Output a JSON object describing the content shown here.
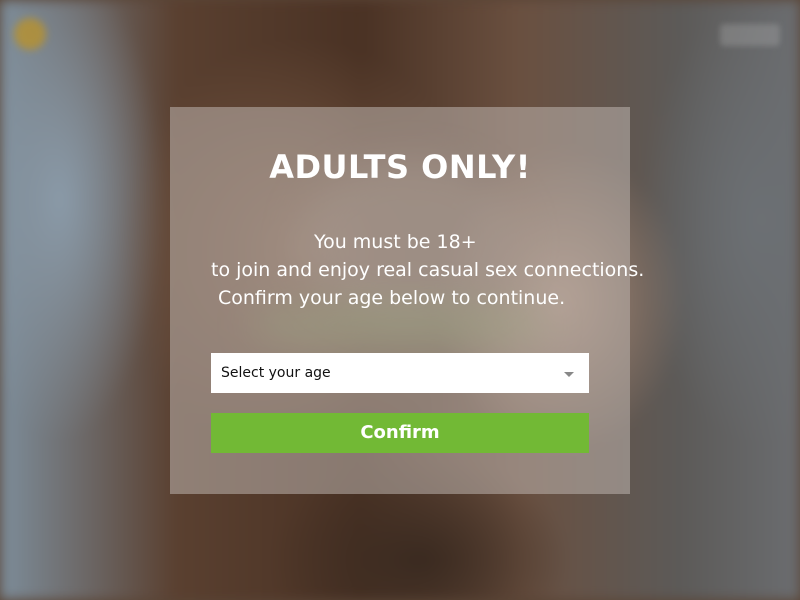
{
  "modal": {
    "title": "ADULTS ONLY!",
    "message_line1": "You must be 18+",
    "message_line2": "to join and enjoy real casual sex connections.",
    "message_line3": "Confirm your age below to continue."
  },
  "age_select": {
    "selected_value": "Select your age"
  },
  "confirm_button": {
    "label": "Confirm"
  },
  "colors": {
    "confirm_green": "#72b935",
    "overlay": "rgba(190,180,175,0.55)"
  }
}
